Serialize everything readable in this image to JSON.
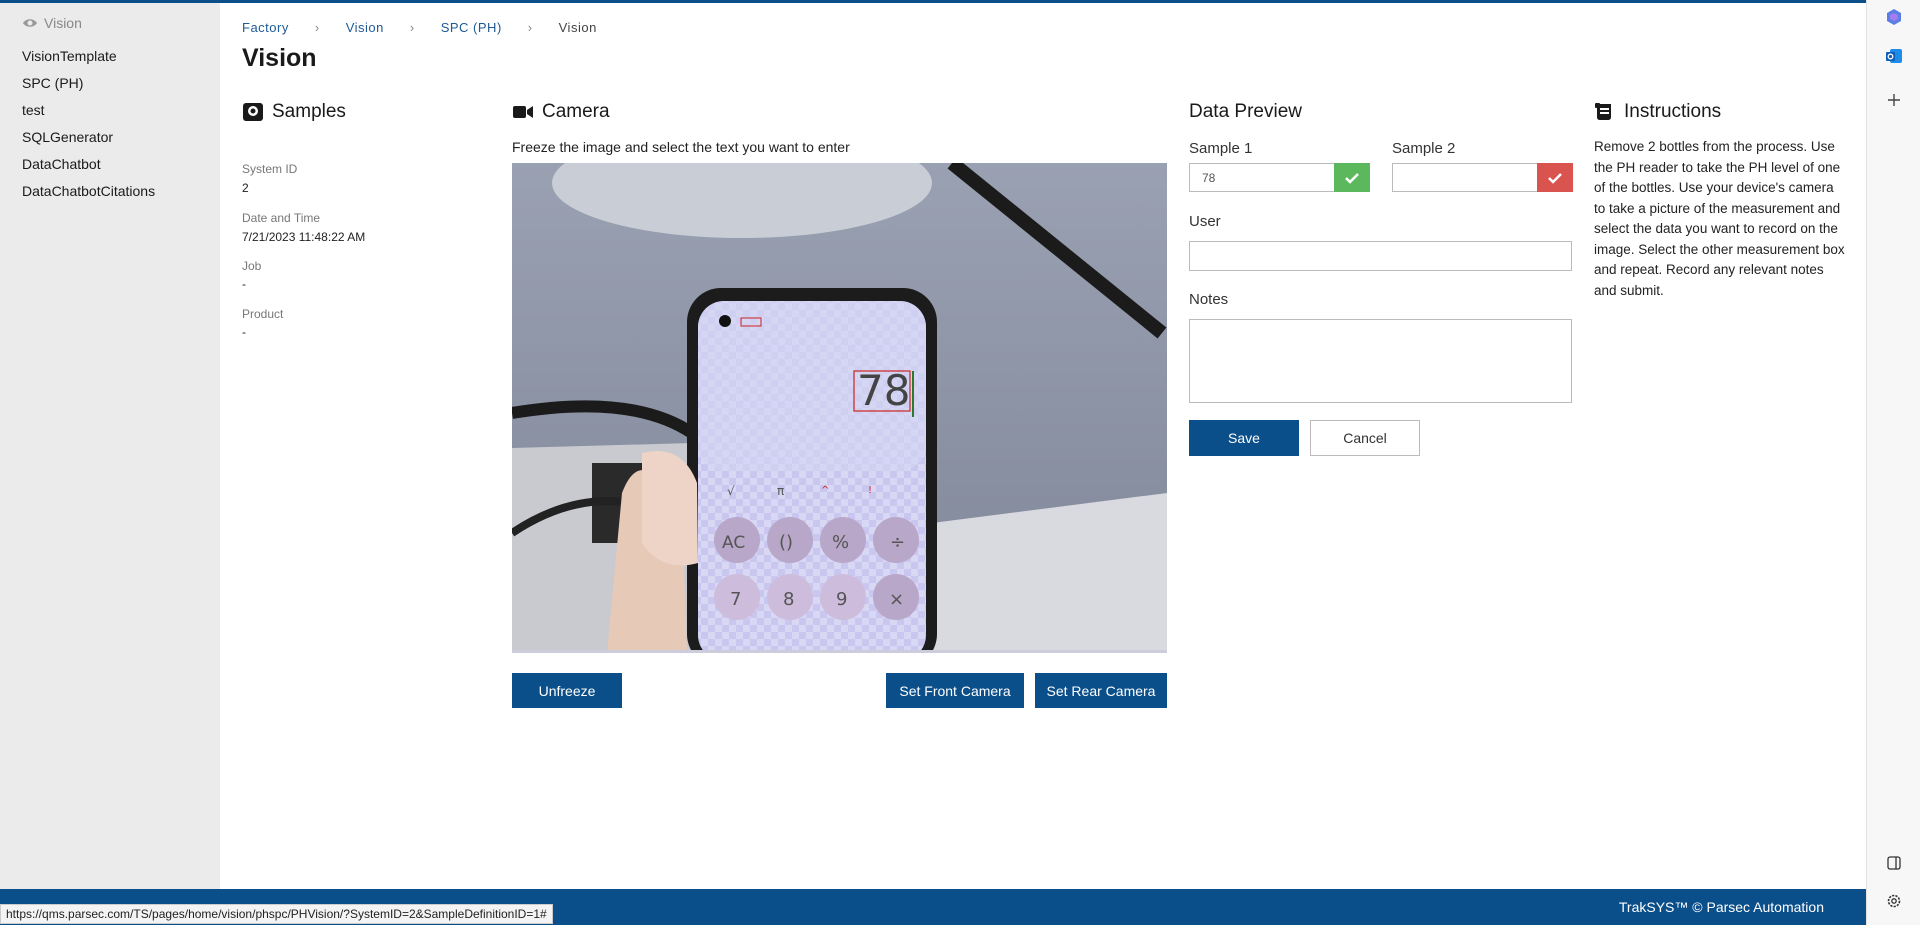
{
  "sidebar": {
    "header": "Vision",
    "items": [
      {
        "label": "VisionTemplate"
      },
      {
        "label": "SPC (PH)"
      },
      {
        "label": "test"
      },
      {
        "label": "SQLGenerator"
      },
      {
        "label": "DataChatbot"
      },
      {
        "label": "DataChatbotCitations"
      }
    ]
  },
  "breadcrumb": [
    "Factory",
    "Vision",
    "SPC (PH)",
    "Vision"
  ],
  "breadcrumb_sep": "›",
  "page_title": "Vision",
  "samples": {
    "title": "Samples",
    "fields": [
      {
        "label": "System ID",
        "value": "2"
      },
      {
        "label": "Date and Time",
        "value": "7/21/2023 11:48:22 AM"
      },
      {
        "label": "Job",
        "value": "-"
      },
      {
        "label": "Product",
        "value": "-"
      }
    ]
  },
  "camera": {
    "title": "Camera",
    "hint": "Freeze the image and select the text you want to enter",
    "calculator_display": "78",
    "unfreeze_label": "Unfreeze",
    "front_label": "Set Front Camera",
    "rear_label": "Set Rear Camera"
  },
  "data_preview": {
    "title": "Data Preview",
    "sample1_label": "Sample 1",
    "sample1_value": "78",
    "sample2_label": "Sample 2",
    "sample2_value": "",
    "user_label": "User",
    "user_value": "",
    "notes_label": "Notes",
    "notes_value": "",
    "save_label": "Save",
    "cancel_label": "Cancel",
    "colors": {
      "ok": "#5cb85c",
      "error": "#d9534f",
      "primary": "#0b4f8a"
    }
  },
  "instructions": {
    "title": "Instructions",
    "text": "Remove 2 bottles from the process. Use the PH reader to take the PH level of one of the bottles. Use your device's camera to take a picture of the measurement and select the data you want to record on the image. Select the other measurement box and repeat. Record any relevant notes and submit."
  },
  "footer": {
    "copyright": "TrakSYS™ © Parsec Automation",
    "status_url": "https://qms.parsec.com/TS/pages/home/vision/phspc/PHVision/?SystemID=2&SampleDefinitionID=1#"
  },
  "edge_icons": [
    "copilot-icon",
    "outlook-icon",
    "add-icon",
    "sidebar-toggle-icon",
    "settings-icon"
  ]
}
